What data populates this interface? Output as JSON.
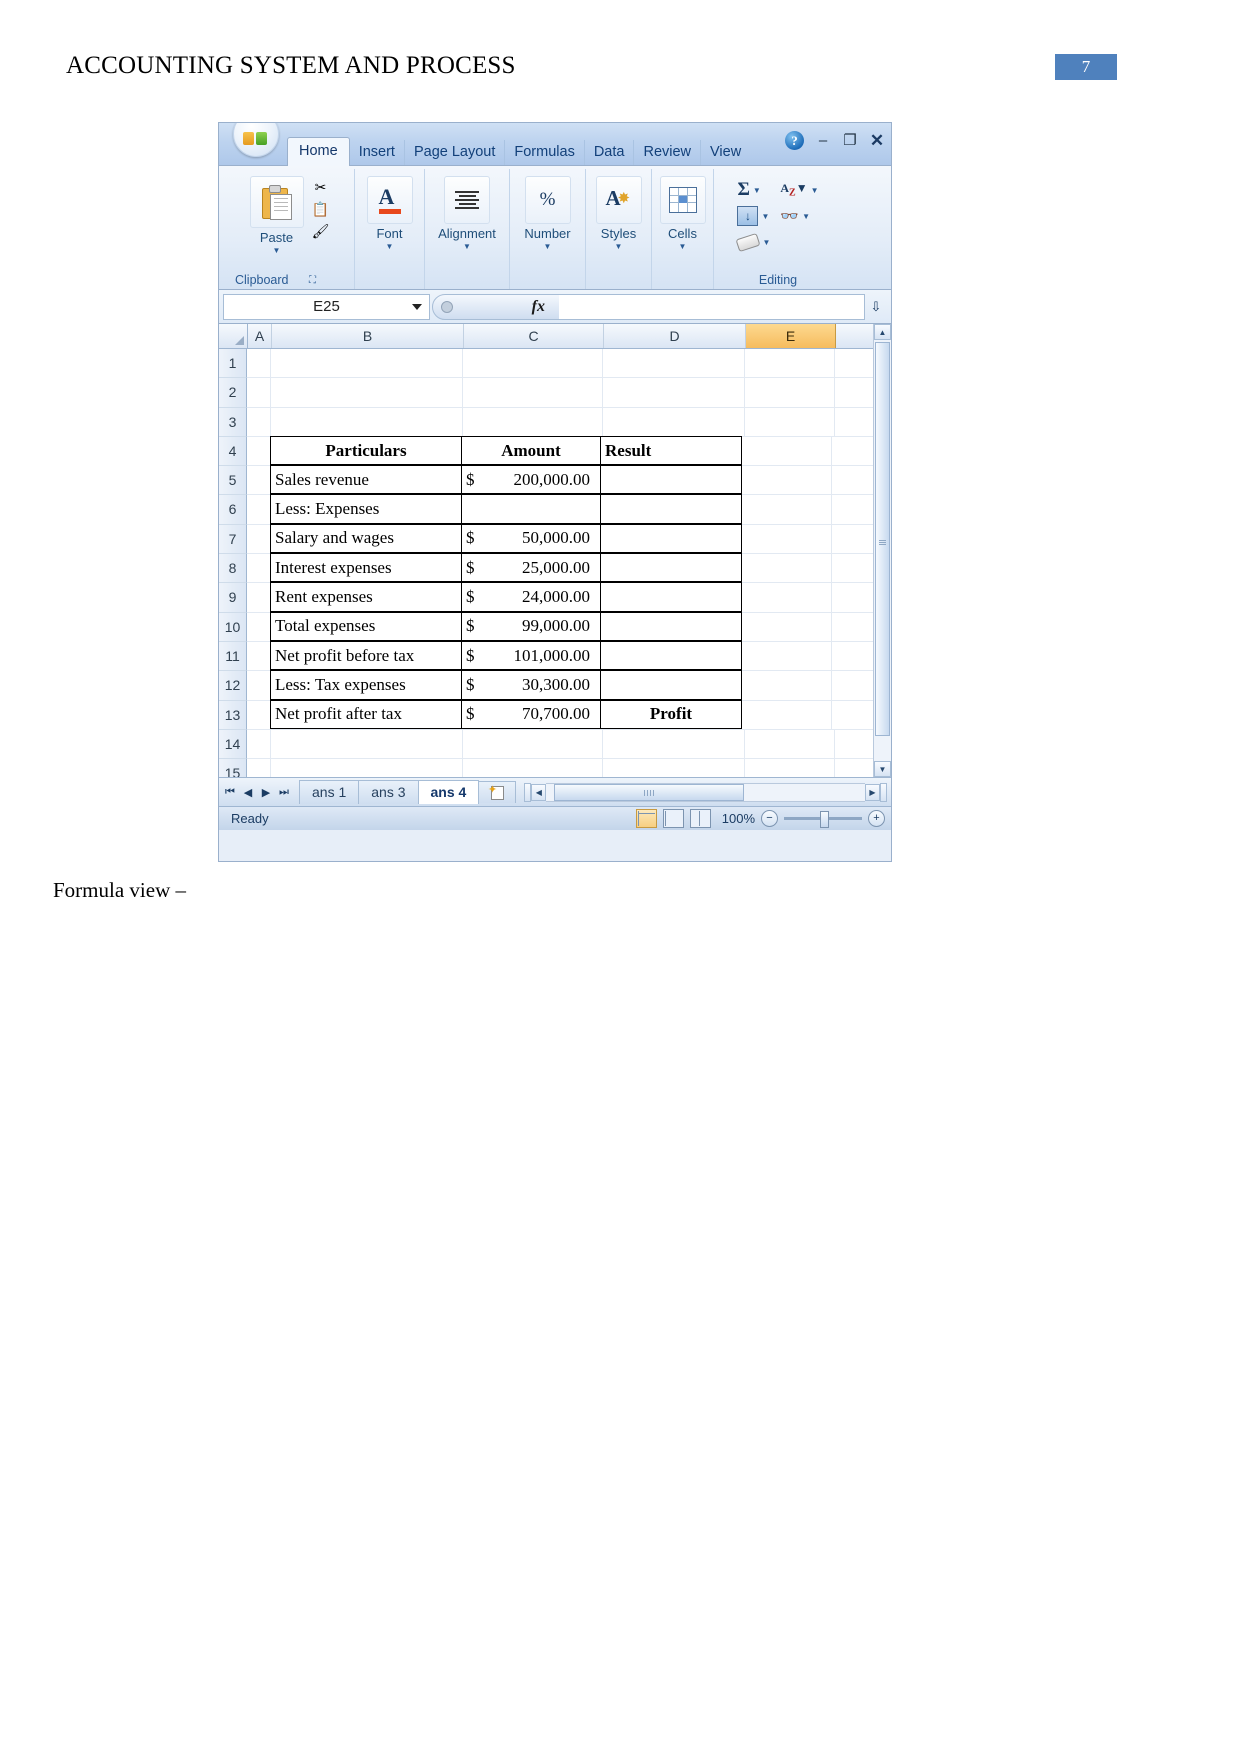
{
  "document": {
    "header_title": "ACCOUNTING SYSTEM AND PROCESS",
    "page_number": "7",
    "caption": "Formula view –",
    "accent_color": "#4f81bd"
  },
  "excel": {
    "office_button": "Office Button",
    "ribbon_tabs": [
      {
        "label": "Home",
        "active": true
      },
      {
        "label": "Insert",
        "active": false
      },
      {
        "label": "Page Layout",
        "active": false
      },
      {
        "label": "Formulas",
        "active": false
      },
      {
        "label": "Data",
        "active": false
      },
      {
        "label": "Review",
        "active": false
      },
      {
        "label": "View",
        "active": false
      }
    ],
    "window_controls": {
      "help": "?",
      "minimize": "–",
      "restore": "❐",
      "close": "✕"
    },
    "ribbon_groups": [
      {
        "name": "Clipboard",
        "button": "Paste",
        "label": "Clipboard",
        "has_launcher": true
      },
      {
        "name": "Font",
        "button": "Font",
        "label": "",
        "has_launcher": false
      },
      {
        "name": "Alignment",
        "button": "Alignment",
        "label": "",
        "has_launcher": false
      },
      {
        "name": "Number",
        "button": "Number",
        "label": "",
        "has_launcher": false
      },
      {
        "name": "Styles",
        "button": "Styles",
        "label": "",
        "has_launcher": false
      },
      {
        "name": "Cells",
        "button": "Cells",
        "label": "",
        "has_launcher": false
      },
      {
        "name": "Editing",
        "button": "",
        "label": "Editing",
        "has_launcher": false
      }
    ],
    "clipboard_label": "Clipboard",
    "editing_label": "Editing",
    "editing_items": [
      "autosum",
      "sort-filter",
      "fill",
      "find-select",
      "clear"
    ],
    "name_box_value": "E25",
    "formula_bar_value": "",
    "fx_label": "fx",
    "columns": [
      "A",
      "B",
      "C",
      "D",
      "E"
    ],
    "selected_column": "E",
    "sheet_tabs": [
      {
        "label": "ans 1",
        "active": false
      },
      {
        "label": "ans 3",
        "active": false
      },
      {
        "label": "ans 4",
        "active": true
      }
    ],
    "status_text": "Ready",
    "zoom_level": "100%"
  },
  "sheet": {
    "rows": [
      {
        "n": "1",
        "b": "",
        "c_cur": "",
        "c_val": "",
        "d": "",
        "boxed": false
      },
      {
        "n": "2",
        "b": "",
        "c_cur": "",
        "c_val": "",
        "d": "",
        "boxed": false
      },
      {
        "n": "3",
        "b": "",
        "c_cur": "",
        "c_val": "",
        "d": "",
        "boxed": false
      },
      {
        "n": "4",
        "b": "Particulars",
        "c_cur": "",
        "c_val": "Amount",
        "d": "Result",
        "boxed": true,
        "header": true
      },
      {
        "n": "5",
        "b": "Sales revenue",
        "c_cur": "$",
        "c_val": "200,000.00",
        "d": "",
        "boxed": true
      },
      {
        "n": "6",
        "b": "Less: Expenses",
        "c_cur": "",
        "c_val": "",
        "d": "",
        "boxed": true
      },
      {
        "n": "7",
        "b": "Salary and wages",
        "c_cur": "$",
        "c_val": "50,000.00",
        "d": "",
        "boxed": true
      },
      {
        "n": "8",
        "b": "Interest expenses",
        "c_cur": "$",
        "c_val": "25,000.00",
        "d": "",
        "boxed": true
      },
      {
        "n": "9",
        "b": "Rent expenses",
        "c_cur": "$",
        "c_val": "24,000.00",
        "d": "",
        "boxed": true
      },
      {
        "n": "10",
        "b": "Total expenses",
        "c_cur": "$",
        "c_val": "99,000.00",
        "d": "",
        "boxed": true
      },
      {
        "n": "11",
        "b": "Net profit before tax",
        "c_cur": "$",
        "c_val": "101,000.00",
        "d": "",
        "boxed": true
      },
      {
        "n": "12",
        "b": "Less: Tax expenses",
        "c_cur": "$",
        "c_val": "30,300.00",
        "d": "",
        "boxed": true
      },
      {
        "n": "13",
        "b": "Net profit after tax",
        "c_cur": "$",
        "c_val": "70,700.00",
        "d": "Profit",
        "boxed": true,
        "bold_d": true
      },
      {
        "n": "14",
        "b": "",
        "c_cur": "",
        "c_val": "",
        "d": "",
        "boxed": false
      },
      {
        "n": "15",
        "b": "",
        "c_cur": "",
        "c_val": "",
        "d": "",
        "boxed": false
      }
    ]
  }
}
